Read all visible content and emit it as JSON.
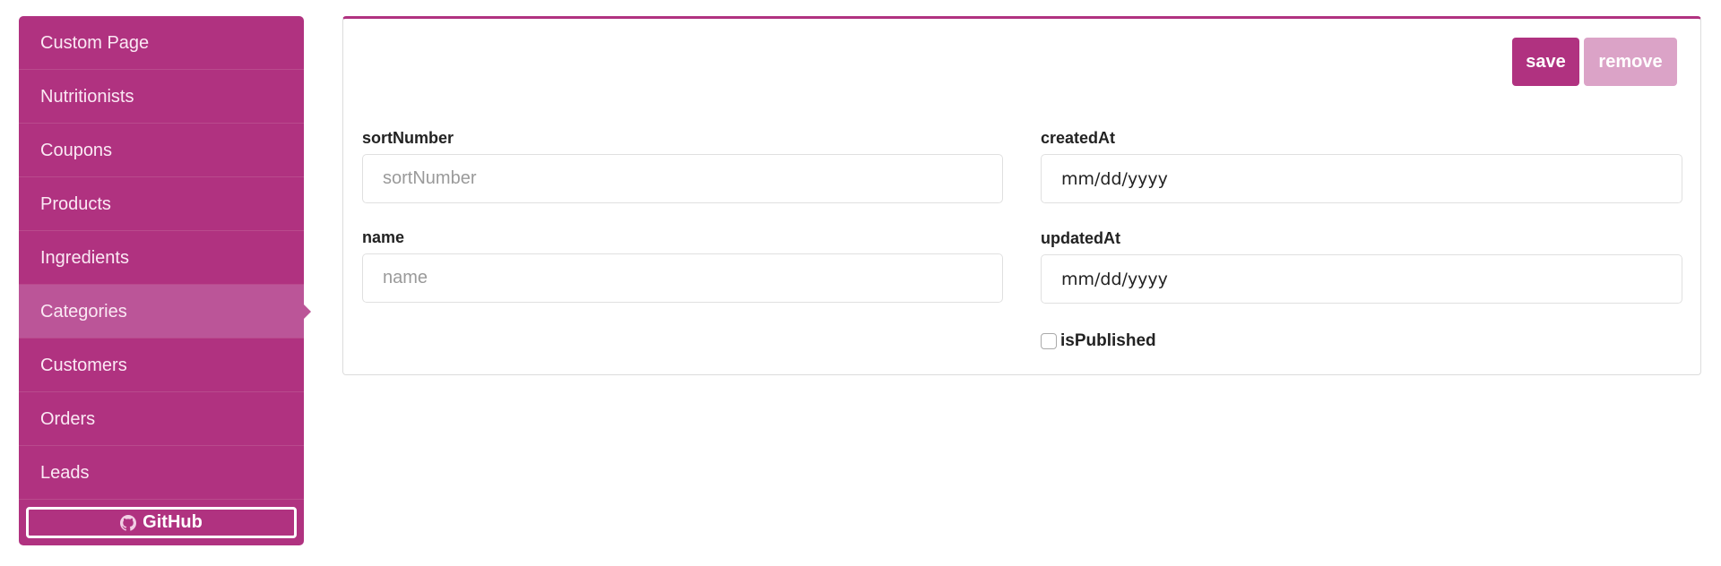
{
  "sidebar": {
    "items": [
      {
        "label": "Custom Page"
      },
      {
        "label": "Nutritionists"
      },
      {
        "label": "Coupons"
      },
      {
        "label": "Products"
      },
      {
        "label": "Ingredients"
      },
      {
        "label": "Categories",
        "active": true
      },
      {
        "label": "Customers"
      },
      {
        "label": "Orders"
      },
      {
        "label": "Leads"
      }
    ],
    "github_label": "GitHub"
  },
  "toolbar": {
    "save_label": "save",
    "remove_label": "remove"
  },
  "form": {
    "sortNumber": {
      "label": "sortNumber",
      "placeholder": "sortNumber",
      "value": ""
    },
    "name": {
      "label": "name",
      "placeholder": "name",
      "value": ""
    },
    "createdAt": {
      "label": "createdAt",
      "value": "mm/dd/yyyy"
    },
    "updatedAt": {
      "label": "updatedAt",
      "value": "mm/dd/yyyy"
    },
    "isPublished": {
      "label": "isPublished",
      "checked": false
    }
  },
  "colors": {
    "brand": "#b03280",
    "active_item": "#bb5598",
    "remove_disabled": "#dba3c7"
  }
}
